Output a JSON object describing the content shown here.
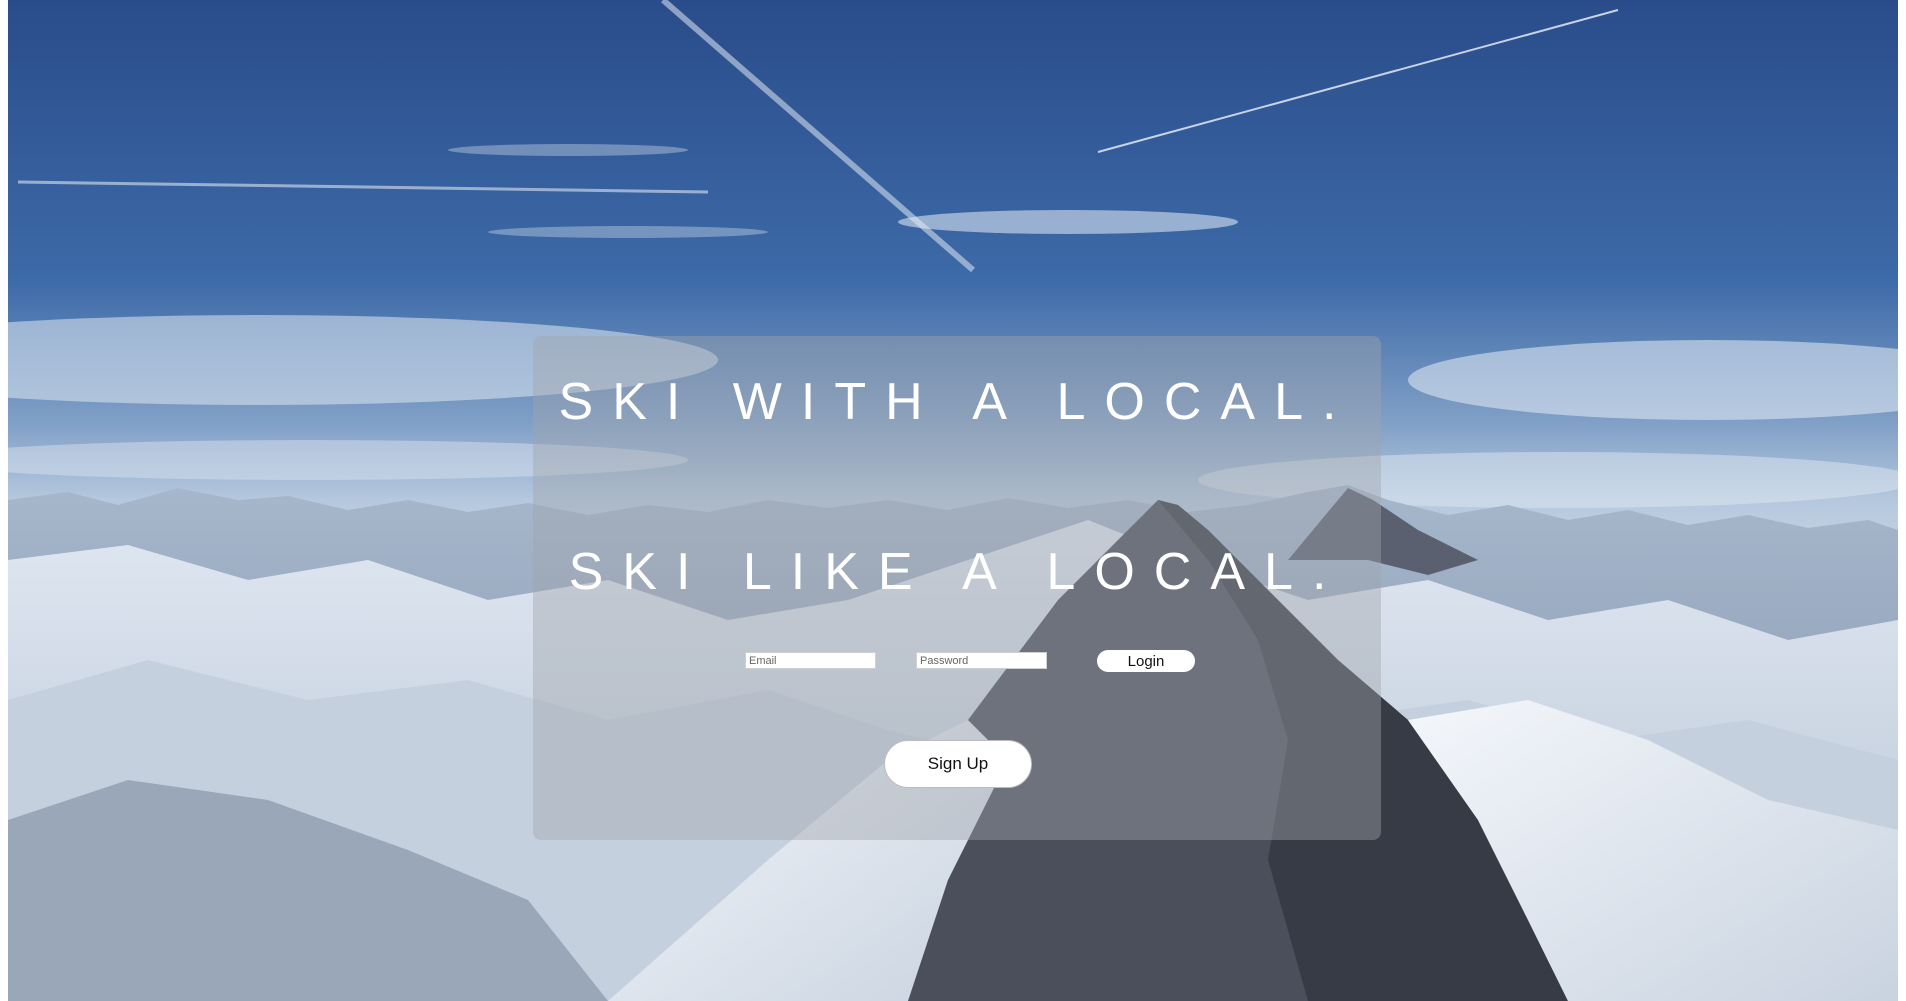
{
  "hero": {
    "headline_1": "SKI WITH A LOCAL.",
    "headline_2": "SKI LIKE A LOCAL."
  },
  "login_form": {
    "email_placeholder": "Email",
    "password_placeholder": "Password",
    "login_label": "Login",
    "signup_label": "Sign Up"
  },
  "colors": {
    "sky_top": "#2a4f8e",
    "sky_bottom": "#a9c1dc",
    "snow": "#eef2f7",
    "rock": "#3a3f4a",
    "panel_overlay": "rgba(160,165,172,0.42)",
    "text": "#ffffff"
  }
}
